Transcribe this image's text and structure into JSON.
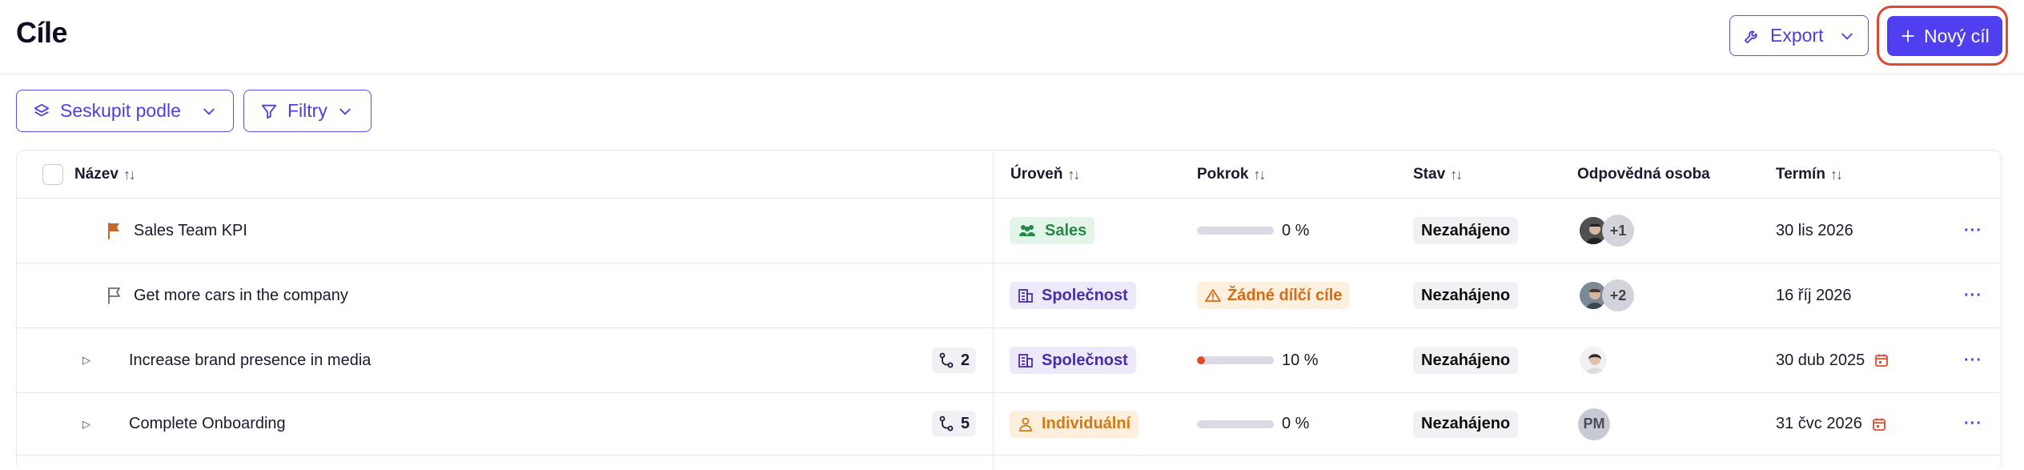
{
  "header": {
    "title": "Cíle",
    "export_label": "Export",
    "new_goal_label": "Nový cíl",
    "accent": "#4f3ff0",
    "highlight": "#e0492c"
  },
  "toolbar": {
    "group_label": "Seskupit podle",
    "filter_label": "Filtry"
  },
  "table": {
    "columns": {
      "name": "Název",
      "level": "Úroveň",
      "progress": "Pokrok",
      "status": "Stav",
      "owner": "Odpovědná osoba",
      "deadline": "Termín"
    },
    "rows": [
      {
        "name": "Sales Team KPI",
        "flag": "filled-flag-icon",
        "level": "Sales",
        "level_icon": "team-icon",
        "progress_percent": 0,
        "progress_text": "0 %",
        "status": "Nezahájeno",
        "owner_extra": "+1",
        "deadline": "30 lis 2026"
      },
      {
        "name": "Get more cars in the company",
        "flag": "outline-flag-icon",
        "level": "Společnost",
        "level_icon": "building-icon",
        "progress_warning": "Žádné dílčí cíle",
        "status": "Nezahájeno",
        "owner_extra": "+2",
        "deadline": "16 říj 2026"
      },
      {
        "name": "Increase brand presence in media",
        "subgoals": "2",
        "level": "Společnost",
        "level_icon": "building-icon",
        "progress_percent": 10,
        "progress_text": "10 %",
        "status": "Nezahájeno",
        "deadline": "30 dub 2025"
      },
      {
        "name": "Complete Onboarding",
        "subgoals": "5",
        "level": "Individuální",
        "level_icon": "person-icon",
        "progress_percent": 0,
        "progress_text": "0 %",
        "status": "Nezahájeno",
        "owner_initials": "PM",
        "deadline": "31 čvc 2026"
      }
    ],
    "more_actions": "···"
  }
}
